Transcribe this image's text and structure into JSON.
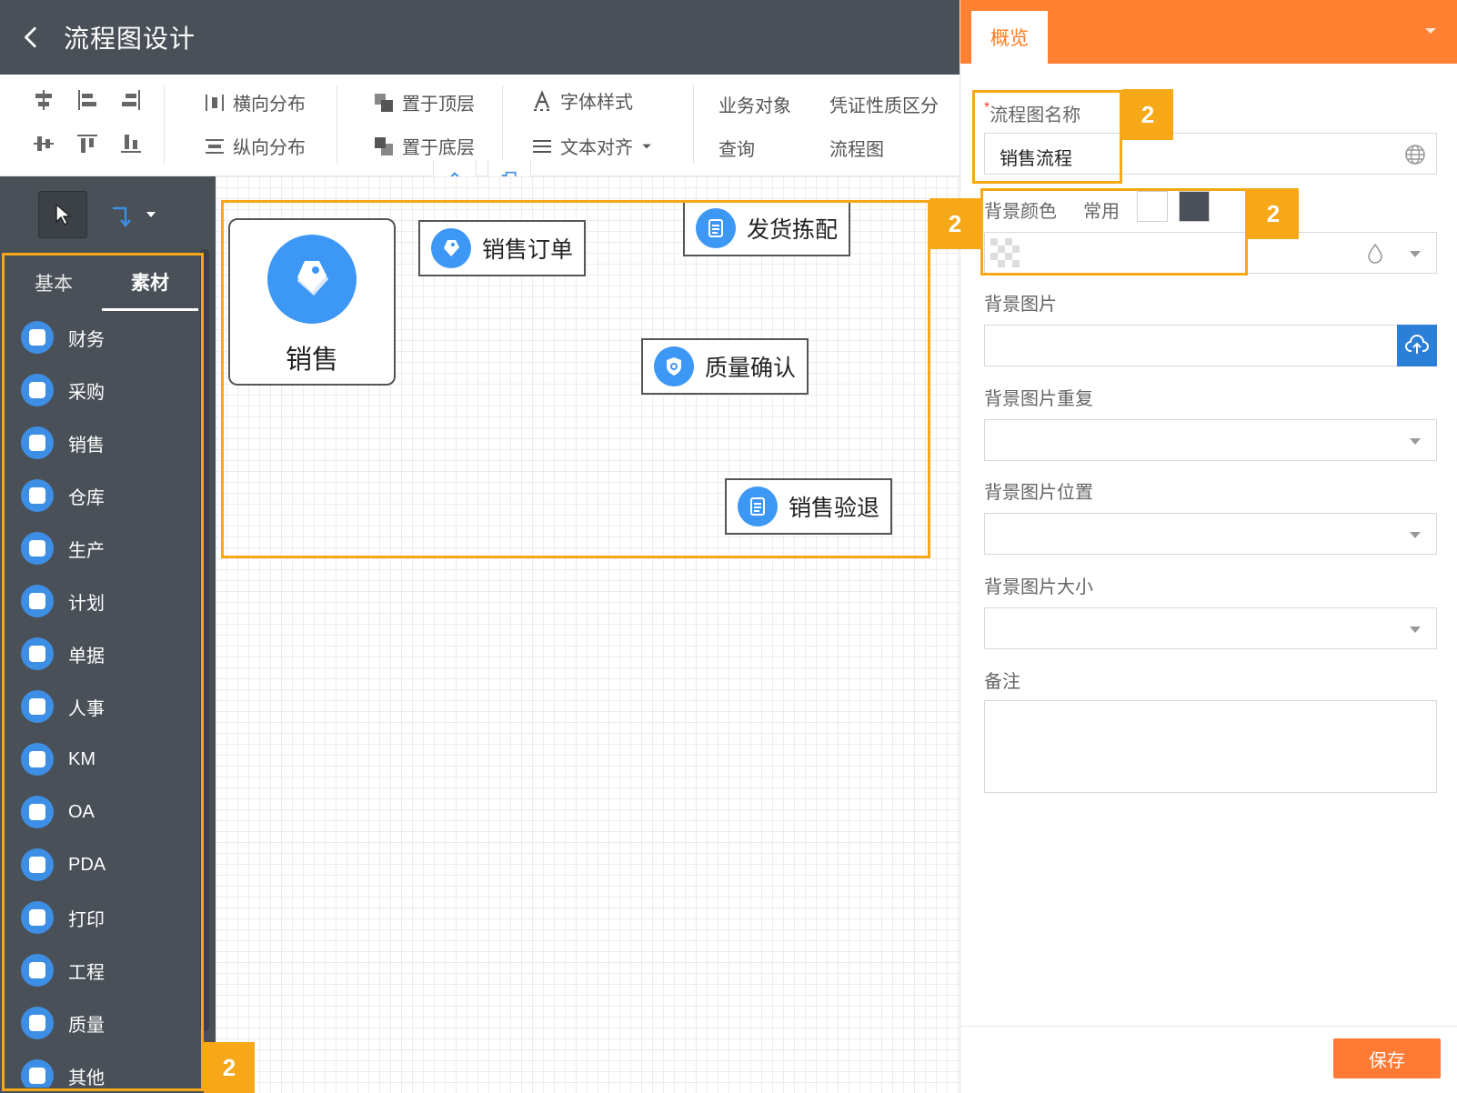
{
  "header": {
    "title": "流程图设计",
    "back_icon": "chevron-left-icon"
  },
  "toolbar": {
    "distribute_h": "横向分布",
    "distribute_v": "纵向分布",
    "bring_front": "置于顶层",
    "send_back": "置于底层",
    "font_style": "字体样式",
    "text_align": "文本对齐",
    "business_object": "业务对象",
    "voucher_nature": "凭证性质区分",
    "query": "查询",
    "flowchart": "流程图"
  },
  "library": {
    "tabs": [
      {
        "label": "基本"
      },
      {
        "label": "素材"
      }
    ],
    "active_tab": "素材",
    "items": [
      {
        "label": "财务",
        "icon": "finance-icon"
      },
      {
        "label": "采购",
        "icon": "cart-icon"
      },
      {
        "label": "销售",
        "icon": "tag-icon"
      },
      {
        "label": "仓库",
        "icon": "warehouse-icon"
      },
      {
        "label": "生产",
        "icon": "production-icon"
      },
      {
        "label": "计划",
        "icon": "plan-icon"
      },
      {
        "label": "单据",
        "icon": "document-icon"
      },
      {
        "label": "人事",
        "icon": "people-icon"
      },
      {
        "label": "KM",
        "icon": "book-icon"
      },
      {
        "label": "OA",
        "icon": "oa-icon"
      },
      {
        "label": "PDA",
        "icon": "pda-icon"
      },
      {
        "label": "打印",
        "icon": "printer-icon"
      },
      {
        "label": "工程",
        "icon": "engineering-icon"
      },
      {
        "label": "质量",
        "icon": "shield-icon"
      },
      {
        "label": "其他",
        "icon": "other-icon"
      }
    ]
  },
  "canvas": {
    "nodes": {
      "sales": "销售",
      "sales_order": "销售订单",
      "shipping": "发货拣配",
      "quality": "质量确认",
      "return": "销售验退"
    }
  },
  "properties": {
    "tab": "概览",
    "name_label": "流程图名称",
    "name_value": "销售流程",
    "bg_color_label": "背景颜色",
    "common_label": "常用",
    "swatch_colors": [
      "#ffffff",
      "#4a5058"
    ],
    "bg_image_label": "背景图片",
    "bg_repeat_label": "背景图片重复",
    "bg_position_label": "背景图片位置",
    "bg_size_label": "背景图片大小",
    "remark_label": "备注",
    "save_label": "保存"
  },
  "annotations": {
    "badge_label": "2"
  },
  "colors": {
    "accent": "#ff8131",
    "header": "#4a5058",
    "node_blue": "#3d97f5",
    "highlight": "#f6a818"
  }
}
